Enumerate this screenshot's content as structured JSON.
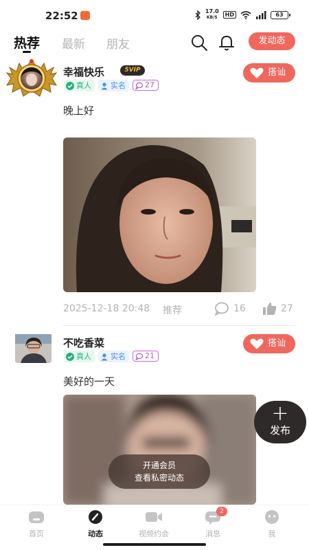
{
  "status_bar": {
    "time": "22:52",
    "speed": "17.0",
    "speed_unit": "KB/S",
    "hd": "HD",
    "battery": "63"
  },
  "header": {
    "tabs": [
      {
        "label": "热荐",
        "active": true
      },
      {
        "label": "最新",
        "active": false
      },
      {
        "label": "朋友",
        "active": false
      }
    ],
    "post_button": "发动态"
  },
  "posts": [
    {
      "username": "幸福快乐",
      "vip": "5VIP",
      "tag_real": "真人",
      "tag_name": "实名",
      "tag_count": "27",
      "chat_label": "搭讪",
      "text": "晚上好",
      "datetime": "2025-12-18 20:48",
      "recommend": "推荐",
      "comments": "16",
      "likes": "27"
    },
    {
      "username": "不吃香菜",
      "tag_real": "真人",
      "tag_name": "实名",
      "tag_count": "21",
      "chat_label": "搭讪",
      "text": "美好的一天"
    }
  ],
  "fab": {
    "label": "发布"
  },
  "vip_overlay": {
    "line1": "开通会员",
    "line2": "查看私密动态"
  },
  "bottom_nav": [
    {
      "label": "首页",
      "icon": "home-icon"
    },
    {
      "label": "动态",
      "icon": "moments-icon",
      "active": true
    },
    {
      "label": "视频约会",
      "icon": "video-icon"
    },
    {
      "label": "消息",
      "icon": "message-icon",
      "badge": "2"
    },
    {
      "label": "我",
      "icon": "profile-icon"
    }
  ],
  "colors": {
    "accent": "#f0675e",
    "real_tag": "#27b07a",
    "name_tag": "#4a8be8",
    "count_tag": "#b656cf"
  }
}
